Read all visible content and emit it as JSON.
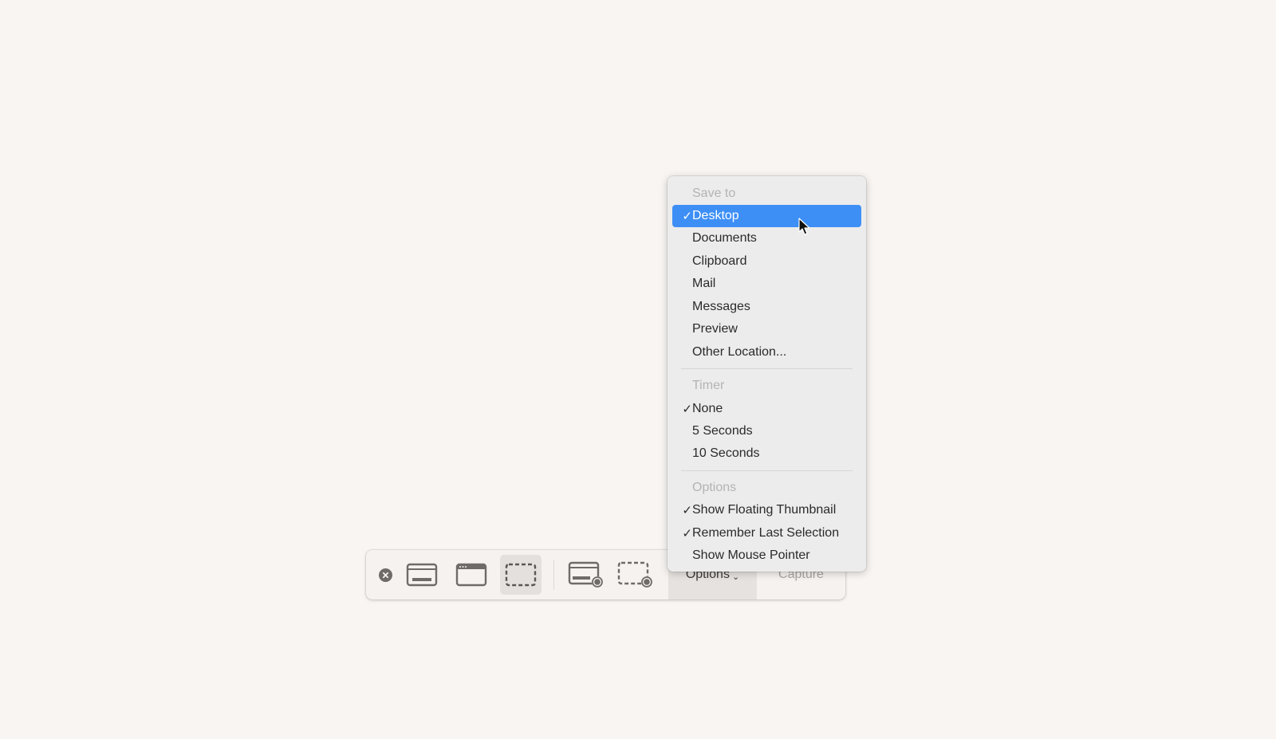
{
  "toolbar": {
    "close_icon": "close-circle-icon",
    "buttons": [
      {
        "name": "capture-entire-screen",
        "icon": "screen-icon",
        "selected": false
      },
      {
        "name": "capture-selected-window",
        "icon": "window-icon",
        "selected": false
      },
      {
        "name": "capture-selected-portion",
        "icon": "dashed-selection-icon",
        "selected": true
      },
      {
        "name": "record-entire-screen",
        "icon": "screen-record-icon",
        "selected": false
      },
      {
        "name": "record-selected-portion",
        "icon": "selection-record-icon",
        "selected": false
      }
    ],
    "options_label": "Options",
    "options_chevron": "⌄",
    "capture_label": "Capture"
  },
  "menu": {
    "sections": [
      {
        "header": "Save to",
        "items": [
          {
            "label": "Desktop",
            "checked": true,
            "highlighted": true
          },
          {
            "label": "Documents",
            "checked": false
          },
          {
            "label": "Clipboard",
            "checked": false
          },
          {
            "label": "Mail",
            "checked": false
          },
          {
            "label": "Messages",
            "checked": false
          },
          {
            "label": "Preview",
            "checked": false
          },
          {
            "label": "Other Location...",
            "checked": false
          }
        ]
      },
      {
        "header": "Timer",
        "items": [
          {
            "label": "None",
            "checked": true
          },
          {
            "label": "5 Seconds",
            "checked": false
          },
          {
            "label": "10 Seconds",
            "checked": false
          }
        ]
      },
      {
        "header": "Options",
        "items": [
          {
            "label": "Show Floating Thumbnail",
            "checked": true
          },
          {
            "label": "Remember Last Selection",
            "checked": true
          },
          {
            "label": "Show Mouse Pointer",
            "checked": false
          }
        ]
      }
    ],
    "check_glyph": "✓"
  },
  "colors": {
    "highlight": "#3d8ff6",
    "background": "#f9f5f2"
  }
}
